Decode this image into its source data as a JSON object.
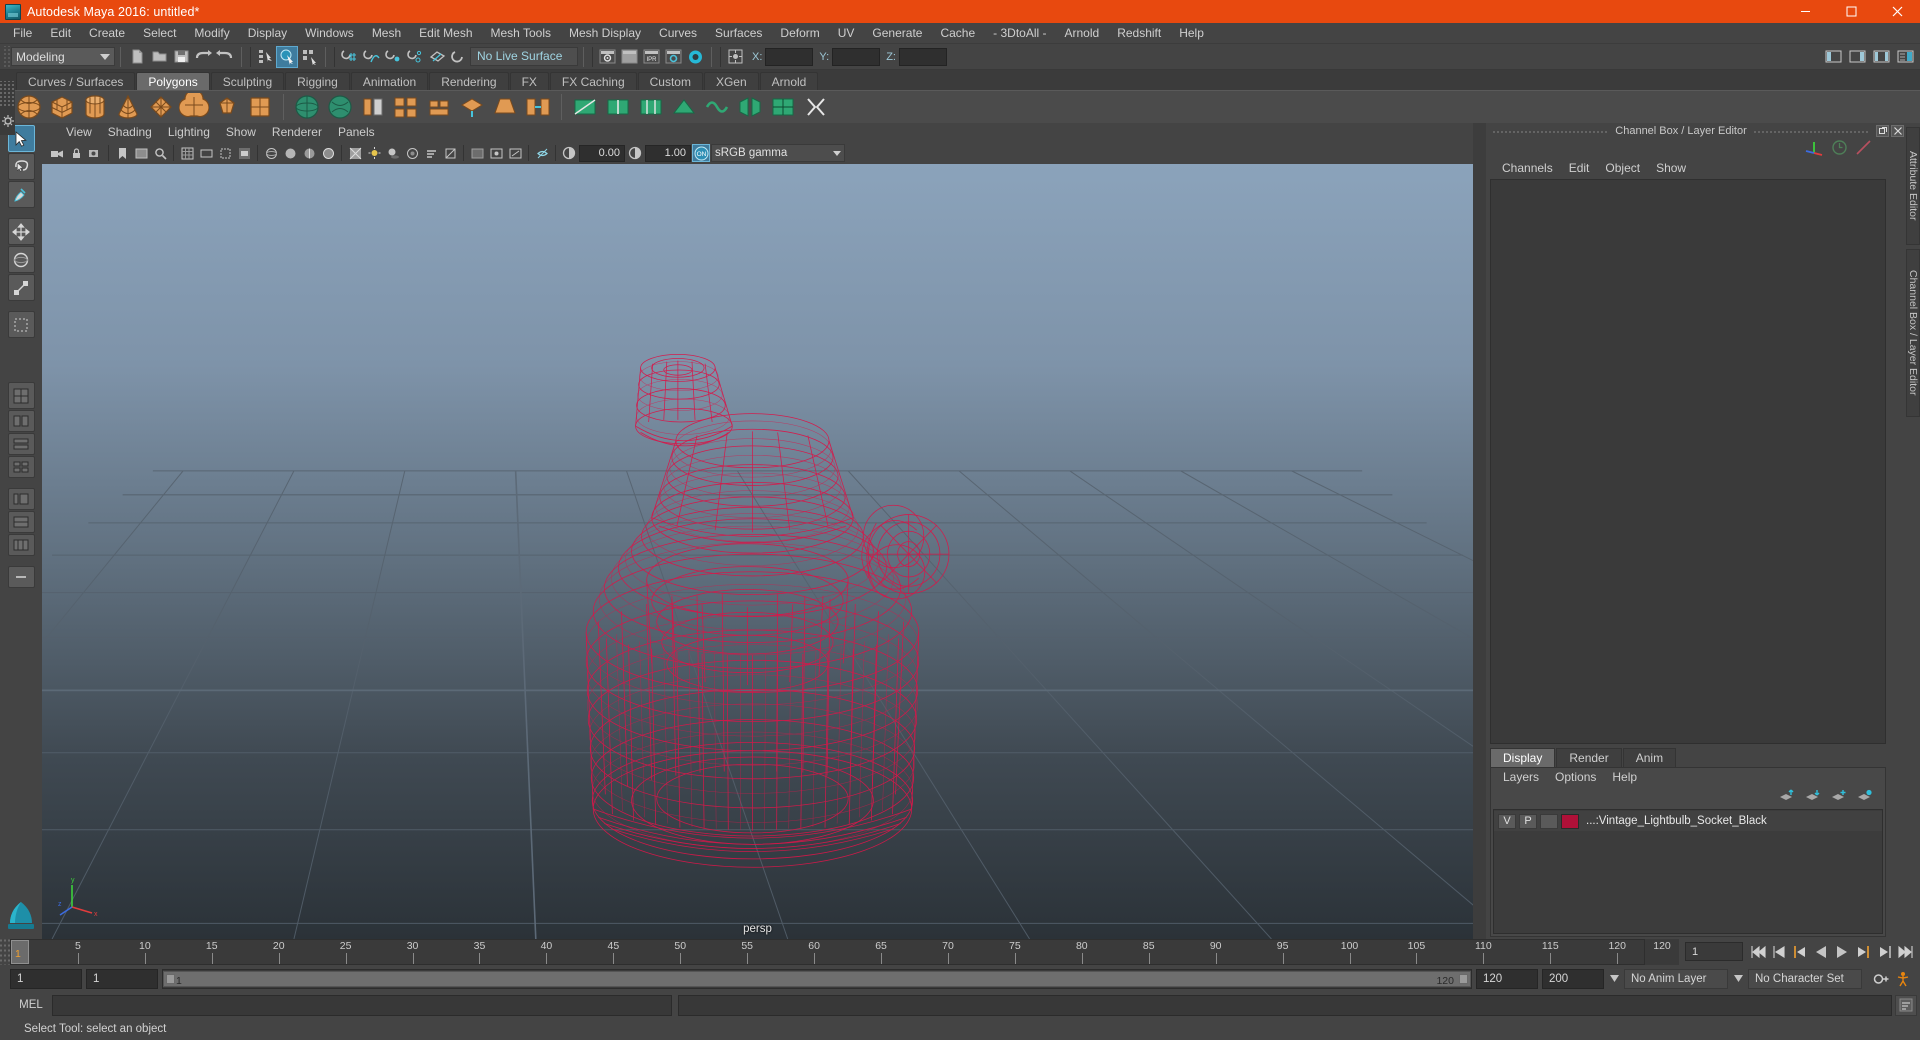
{
  "window": {
    "title": "Autodesk Maya 2016: untitled*",
    "app_icon": "maya-logo-icon",
    "buttons": [
      {
        "name": "minimize-button",
        "glyph": "minimize-icon"
      },
      {
        "name": "maximize-button",
        "glyph": "maximize-icon"
      },
      {
        "name": "close-button",
        "glyph": "close-icon"
      }
    ]
  },
  "menubar": {
    "items": [
      "File",
      "Edit",
      "Create",
      "Select",
      "Modify",
      "Display",
      "Windows",
      "Mesh",
      "Edit Mesh",
      "Mesh Tools",
      "Mesh Display",
      "Curves",
      "Surfaces",
      "Deform",
      "UV",
      "Generate",
      "Cache",
      "- 3DtoAll -",
      "Arnold",
      "Redshift",
      "Help"
    ]
  },
  "statusbar": {
    "menu_set": "Modeling",
    "live_surface": "No Live Surface",
    "coords": {
      "x_label": "X:",
      "y_label": "Y:",
      "z_label": "Z:",
      "x_value": "",
      "y_value": "",
      "z_value": ""
    },
    "ipr_label": "IPR",
    "icons": [
      "new-scene-icon",
      "open-scene-icon",
      "save-scene-icon",
      "undo-icon",
      "redo-icon",
      "select-hierarchy-icon",
      "select-object-icon",
      "select-component-icon",
      "snap-grid-icon",
      "snap-curve-icon",
      "snap-point-icon",
      "snap-projected-center-icon",
      "snap-view-plane-icon",
      "make-live-icon",
      "render-view-icon",
      "render-current-frame-icon",
      "ipr-render-icon",
      "render-settings-icon",
      "hypershade-icon",
      "input-output-connections-icon",
      "show-hide-editors-icon",
      "show-hide-attribute-editor-icon",
      "show-hide-tool-settings-icon",
      "show-hide-channel-box-icon"
    ]
  },
  "shelf": {
    "tabs": [
      "Curves / Surfaces",
      "Polygons",
      "Sculpting",
      "Rigging",
      "Animation",
      "Rendering",
      "FX",
      "FX Caching",
      "Custom",
      "XGen",
      "Arnold"
    ],
    "active_tab": "Polygons",
    "icons": [
      "poly-sphere-icon",
      "poly-cube-icon",
      "poly-cylinder-icon",
      "poly-cone-icon",
      "poly-torus-icon",
      "poly-plane-icon",
      "poly-disc-icon",
      "poly-platonic-icon",
      "sphere-shaded-icon",
      "cube-shaded-icon",
      "combine-icon",
      "booleans-icon",
      "smooth-icon",
      "extrude-icon",
      "bevel-icon",
      "bridge-icon",
      "multi-cut-icon",
      "insert-edge-loop-icon",
      "offset-edge-loop-icon",
      "target-weld-icon",
      "quad-draw-icon",
      "mirror-icon",
      "uv-planar-icon",
      "uv-cylindrical-icon",
      "uv-spherical-icon",
      "uv-automatic-icon",
      "uv-camera-icon",
      "uv-editor-icon",
      "uv-cut-icon"
    ]
  },
  "toolbox": {
    "tools": [
      {
        "name": "select-tool",
        "icon": "arrow-cursor-icon",
        "selected": true
      },
      {
        "name": "lasso-tool",
        "icon": "lasso-icon",
        "selected": false
      },
      {
        "name": "paint-select-tool",
        "icon": "paint-brush-icon",
        "selected": false
      },
      {
        "name": "move-tool",
        "icon": "move-arrows-icon",
        "selected": false
      },
      {
        "name": "rotate-tool",
        "icon": "rotate-circle-icon",
        "selected": false
      },
      {
        "name": "scale-tool",
        "icon": "scale-box-icon",
        "selected": false
      },
      {
        "name": "last-tool",
        "icon": "last-used-tool-icon",
        "selected": false
      },
      {
        "name": "layout-single-pane",
        "icon": "single-pane-icon",
        "selected": false
      },
      {
        "name": "layout-two-pane-side",
        "icon": "two-pane-side-icon",
        "selected": false
      },
      {
        "name": "layout-two-pane-stacked",
        "icon": "two-pane-stacked-icon",
        "selected": false
      },
      {
        "name": "layout-four-pane",
        "icon": "four-pane-icon",
        "selected": false
      },
      {
        "name": "layout-persp-outliner",
        "icon": "persp-outliner-icon",
        "selected": false
      },
      {
        "name": "layout-hypershade",
        "icon": "hypershade-layout-icon",
        "selected": false
      },
      {
        "name": "layout-more",
        "icon": "more-layouts-icon",
        "selected": false
      }
    ],
    "axis_icon": "maya-axis-logo-icon"
  },
  "viewport": {
    "menus": [
      "View",
      "Shading",
      "Lighting",
      "Show",
      "Renderer",
      "Panels"
    ],
    "camera_label": "persp",
    "exposure_value": "0.00",
    "gamma_value": "1.00",
    "color_management": "sRGB gamma",
    "color_management_toggle": "ON",
    "toolbar_icons": [
      "select-camera-icon",
      "lock-camera-icon",
      "camera-attributes-icon",
      "bookmarks-icon",
      "image-plane-icon",
      "two-d-pan-zoom-icon",
      "grid-toggle-icon",
      "film-gate-icon",
      "resolution-gate-icon",
      "gate-mask-icon",
      "wireframe-icon",
      "smooth-shade-icon",
      "smooth-shade-all-icon",
      "wireframe-on-shaded-icon",
      "texture-toggle-icon",
      "lighting-toggle-icon",
      "shadows-toggle-icon",
      "screen-space-ao-icon",
      "motion-blur-icon",
      "multisample-icon",
      "depth-peel-icon",
      "xray-toggle-icon",
      "xray-joints-icon",
      "xray-active-icon",
      "isolate-select-icon",
      "exposure-icon",
      "gamma-icon",
      "color-management-icon"
    ],
    "object_color": "#d6184a",
    "object_name": "Vintage Lightbulb Socket wireframe"
  },
  "right_panel": {
    "title": "Channel Box / Layer Editor",
    "dock_buttons": [
      "undock-icon",
      "close-icon"
    ],
    "toolbar_icons": [
      "transform-axis-icon",
      "anim-clock-icon",
      "input-output-icon"
    ],
    "channelbox_menus": [
      "Channels",
      "Edit",
      "Object",
      "Show"
    ],
    "layer_tabs": [
      "Display",
      "Render",
      "Anim"
    ],
    "active_layer_tab": "Display",
    "layer_menus": [
      "Layers",
      "Options",
      "Help"
    ],
    "layer_buttons": [
      "move-layer-up-icon",
      "move-layer-down-icon",
      "new-layer-icon",
      "new-layer-from-selected-icon"
    ],
    "layers": [
      {
        "visibility": "V",
        "playback": "P",
        "shading": "",
        "color": "#b01038",
        "name": "...:Vintage_Lightbulb_Socket_Black"
      }
    ],
    "vertical_tabs": [
      "Attribute Editor",
      "Channel Box / Layer Editor"
    ]
  },
  "timeline": {
    "ticks": [
      5,
      10,
      15,
      20,
      25,
      30,
      35,
      40,
      45,
      50,
      55,
      60,
      65,
      70,
      75,
      80,
      85,
      90,
      95,
      100,
      105,
      110,
      115,
      120
    ],
    "current_frame": "1",
    "end_tick_label": "120",
    "frame_field": "1",
    "playback_buttons": [
      "go-to-start-icon",
      "step-back-keyframe-icon",
      "step-back-frame-icon",
      "play-backwards-icon",
      "play-forwards-icon",
      "step-forward-frame-icon",
      "step-forward-keyframe-icon",
      "go-to-end-icon"
    ]
  },
  "range_bar": {
    "anim_start": "1",
    "range_start": "1",
    "slider_start_label": "1",
    "slider_end_label": "120",
    "range_end": "120",
    "anim_end": "200",
    "anim_layer": "No Anim Layer",
    "character_set": "No Character Set",
    "icons": [
      "auto-key-icon",
      "animation-preferences-icon"
    ]
  },
  "mel": {
    "label": "MEL",
    "output": "",
    "input": "",
    "script_editor_icon": "script-editor-icon"
  },
  "statusline": {
    "text": "Select Tool: select an object"
  },
  "colors": {
    "title_bar": "#e8490f",
    "chrome": "#444444",
    "accent": "#3f7c9e",
    "shelf_icon": "#e09a53",
    "wireframe": "#d6184a"
  }
}
